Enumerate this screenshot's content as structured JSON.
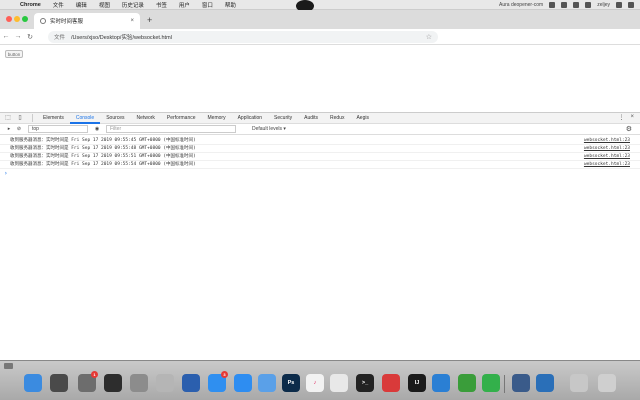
{
  "menubar": {
    "apple": "",
    "app": "Chrome",
    "items": [
      "文件",
      "编辑",
      "视图",
      "历史记录",
      "书签",
      "用户",
      "窗口",
      "帮助"
    ],
    "center_icon": "",
    "status_text": "Aura deopener-com",
    "user": "zeljey"
  },
  "tab": {
    "title": "实时时间客服",
    "close": "×"
  },
  "newtab": "+",
  "address": {
    "scheme": "文件",
    "url": "/Users/xjso/Desktop/实验/websocket.html"
  },
  "page": {
    "button_label": "button"
  },
  "devtools": {
    "tabs": [
      "Elements",
      "Console",
      "Sources",
      "Network",
      "Performance",
      "Memory",
      "Application",
      "Security",
      "Audits",
      "Redux",
      "Aegis"
    ],
    "active_tab": "Console",
    "context": "top",
    "filter_placeholder": "Filter",
    "levels": "Default levels ▾",
    "logs": [
      {
        "text": "收到服务器消息：实时时间是 Fri Sep 17 2019 09:55:45 GMT+0800 (中国标准时间)",
        "source": "websocket.html:23"
      },
      {
        "text": "收到服务器消息：实时时间是 Fri Sep 17 2019 09:55:48 GMT+0800 (中国标准时间)",
        "source": "websocket.html:23"
      },
      {
        "text": "收到服务器消息：实时时间是 Fri Sep 17 2019 09:55:51 GMT+0800 (中国标准时间)",
        "source": "websocket.html:23"
      },
      {
        "text": "收到服务器消息：实时时间是 Fri Sep 17 2019 09:55:54 GMT+0800 (中国标准时间)",
        "source": "websocket.html:23"
      }
    ],
    "prompt": "›"
  },
  "dock": {
    "apps": [
      {
        "name": "finder",
        "label": "",
        "color": "#3b8be0"
      },
      {
        "name": "launchpad",
        "label": "",
        "color": "#4a4a4a"
      },
      {
        "name": "system-preferences",
        "label": "",
        "color": "#6d6d6d",
        "badge": "1"
      },
      {
        "name": "activity-monitor",
        "label": "",
        "color": "#2d2d2d"
      },
      {
        "name": "image-capture",
        "label": "",
        "color": "#8c8c8c"
      },
      {
        "name": "notes-stack",
        "label": "",
        "color": "#b5b5b5"
      },
      {
        "name": "compass",
        "label": "",
        "color": "#2b5fae"
      },
      {
        "name": "app-store",
        "label": "",
        "color": "#2f8ff0",
        "badge": "3"
      },
      {
        "name": "safari",
        "label": "",
        "color": "#2e8df1"
      },
      {
        "name": "browser",
        "label": "",
        "color": "#5aa0e8"
      },
      {
        "name": "photoshop",
        "label": "Ps",
        "color": "#0c2b4a"
      },
      {
        "name": "music",
        "label": "♪",
        "color": "#f2f2f2"
      },
      {
        "name": "chrome",
        "label": "",
        "color": "#e8e8e8"
      },
      {
        "name": "terminal",
        "label": ">_",
        "color": "#222222"
      },
      {
        "name": "netease-music",
        "label": "",
        "color": "#d93a3a"
      },
      {
        "name": "intellij",
        "label": "IJ",
        "color": "#1a1a1a"
      },
      {
        "name": "vscode",
        "label": "",
        "color": "#2a7fd4"
      },
      {
        "name": "wechat-dev",
        "label": "",
        "color": "#3a9d3a"
      },
      {
        "name": "wechat",
        "label": "",
        "color": "#33b04b"
      },
      {
        "name": "screen-app",
        "label": "",
        "color": "#3a5b8a"
      },
      {
        "name": "quicktime",
        "label": "",
        "color": "#2a6fb8"
      },
      {
        "name": "document-viewer",
        "label": "",
        "color": "#c7c7c7"
      },
      {
        "name": "trash",
        "label": "",
        "color": "#cfcfcf"
      }
    ]
  }
}
